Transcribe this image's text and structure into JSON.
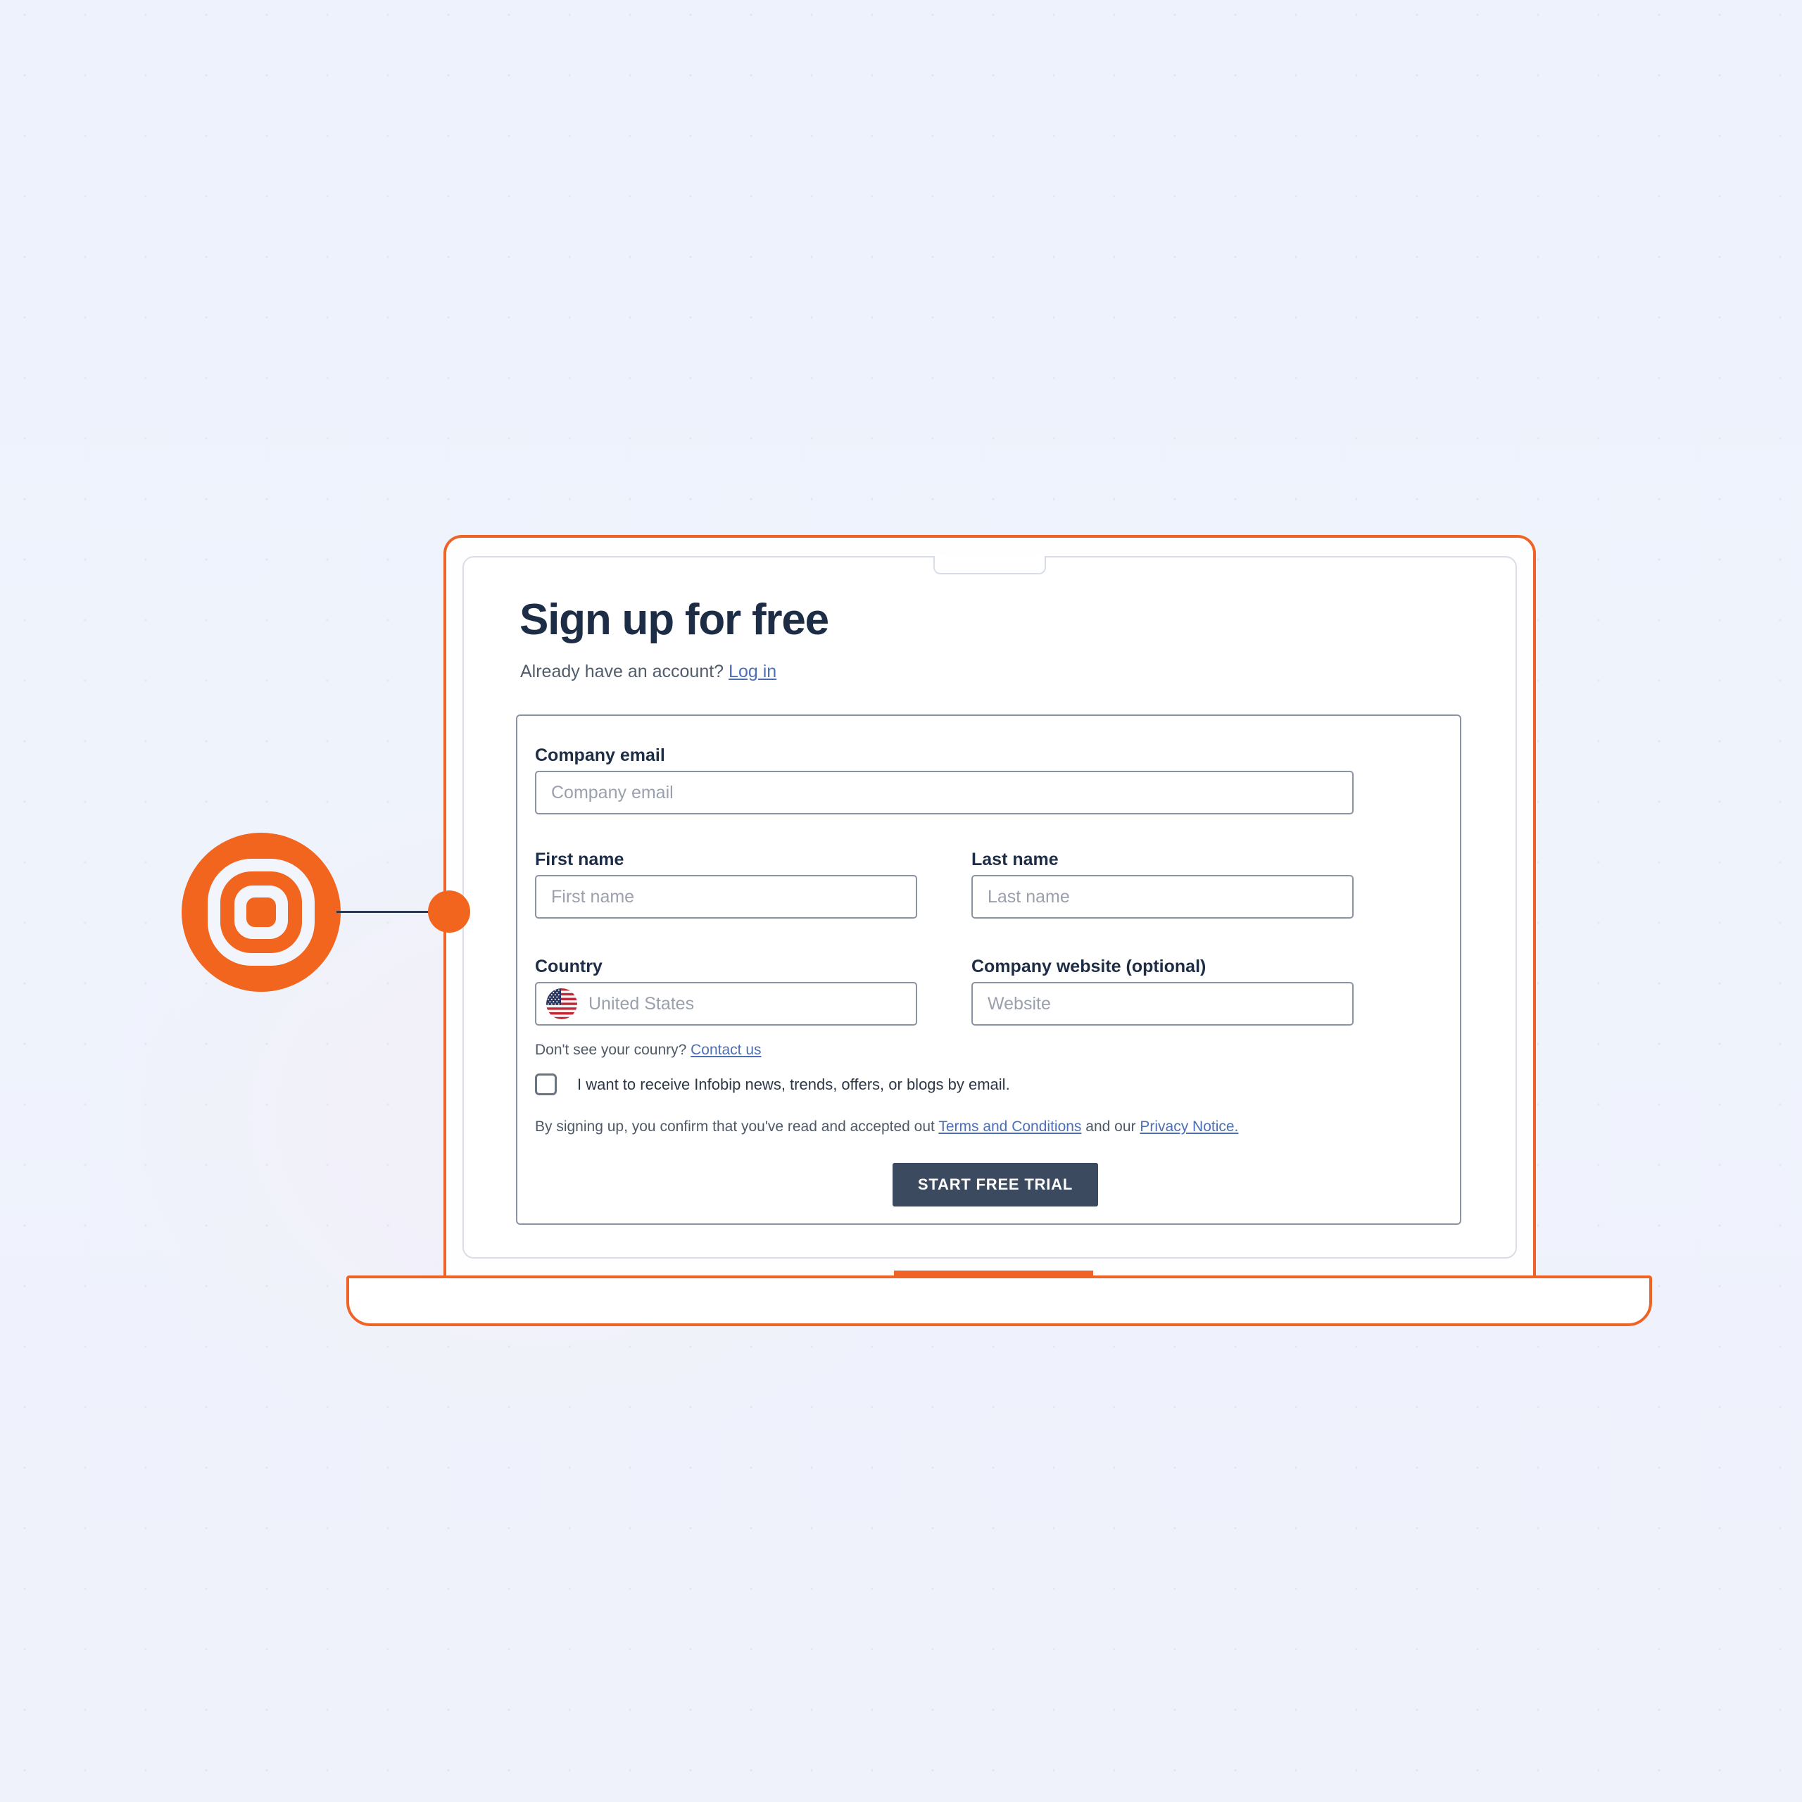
{
  "page": {
    "heading": "Sign up for free",
    "sub_prefix": "Already have an account? ",
    "login_link": "Log in"
  },
  "form": {
    "email": {
      "label": "Company email",
      "placeholder": "Company email",
      "value": ""
    },
    "first_name": {
      "label": "First name",
      "placeholder": "First name",
      "value": ""
    },
    "last_name": {
      "label": "Last name",
      "placeholder": "Last name",
      "value": ""
    },
    "country": {
      "label": "Country",
      "placeholder": "United States",
      "value": "United States",
      "flag_icon": "us-flag-icon"
    },
    "website": {
      "label": "Company website (optional)",
      "placeholder": "Website",
      "value": ""
    },
    "country_helper_prefix": "Don't see your counry? ",
    "country_helper_link": "Contact us",
    "newsletter_checkbox_label": "I want to receive Infobip news, trends, offers, or blogs by email.",
    "newsletter_checked": false,
    "legal_prefix": "By signing up, you confirm that you've read and accepted out ",
    "legal_terms_link": "Terms and Conditions",
    "legal_middle": " and our ",
    "legal_privacy_link": "Privacy Notice.",
    "submit_label": "START FREE TRIAL"
  },
  "annotation": {
    "marker_icon": "bullseye-target-icon",
    "connector_icon": "connector-line-icon",
    "endpoint_icon": "connector-dot-icon"
  },
  "device": {
    "frame_icon": "laptop-frame-icon",
    "base_icon": "laptop-base-icon",
    "trackpad_icon": "trackpad-notch-icon",
    "screen_tab_icon": "browser-tab-notch-icon"
  },
  "colors": {
    "brand_orange": "#ef6426",
    "accent_orange": "#f2651f",
    "heading_navy": "#1e2d46",
    "cta_navy": "#3c4a60",
    "link_blue": "#4c6fb5",
    "border_gray": "#8b94a3",
    "background": "#eef2fb"
  }
}
